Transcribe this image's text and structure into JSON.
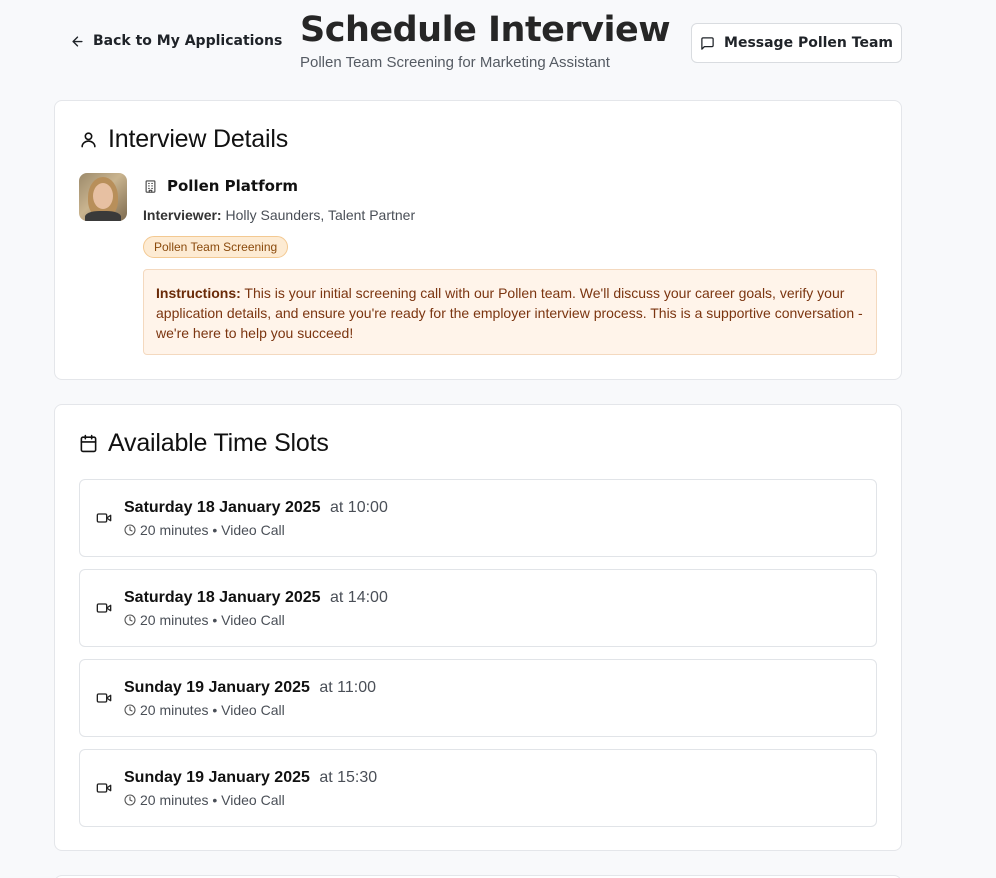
{
  "header": {
    "back_label": "Back to My Applications",
    "title": "Schedule Interview",
    "subtitle": "Pollen Team Screening for Marketing Assistant",
    "message_label": "Message Pollen Team"
  },
  "details": {
    "title": "Interview Details",
    "platform": "Pollen Platform",
    "interviewer_label": "Interviewer:",
    "interviewer_value": "Holly Saunders, Talent Partner",
    "badge": "Pollen Team Screening",
    "instructions_label": "Instructions:",
    "instructions_text": "This is your initial screening call with our Pollen team. We'll discuss your career goals, verify your application details, and ensure you're ready for the employer interview process. This is a supportive conversation - we're here to help you succeed!"
  },
  "slots": {
    "title": "Available Time Slots",
    "items": [
      {
        "date": "Saturday 18 January 2025",
        "time": "at 10:00",
        "meta": "20 minutes • Video Call"
      },
      {
        "date": "Saturday 18 January 2025",
        "time": "at 14:00",
        "meta": "20 minutes • Video Call"
      },
      {
        "date": "Sunday 19 January 2025",
        "time": "at 11:00",
        "meta": "20 minutes • Video Call"
      },
      {
        "date": "Sunday 19 January 2025",
        "time": "at 15:30",
        "meta": "20 minutes • Video Call"
      }
    ]
  },
  "icons": {
    "back": "arrow-left-icon",
    "message": "message-square-icon",
    "user": "user-icon",
    "building": "building-icon",
    "calendar": "calendar-icon",
    "video": "video-icon",
    "clock": "clock-icon"
  },
  "colors": {
    "badge_bg": "#fdebd3",
    "instructions_bg": "#fff4ea",
    "instructions_text": "#7b3510"
  }
}
